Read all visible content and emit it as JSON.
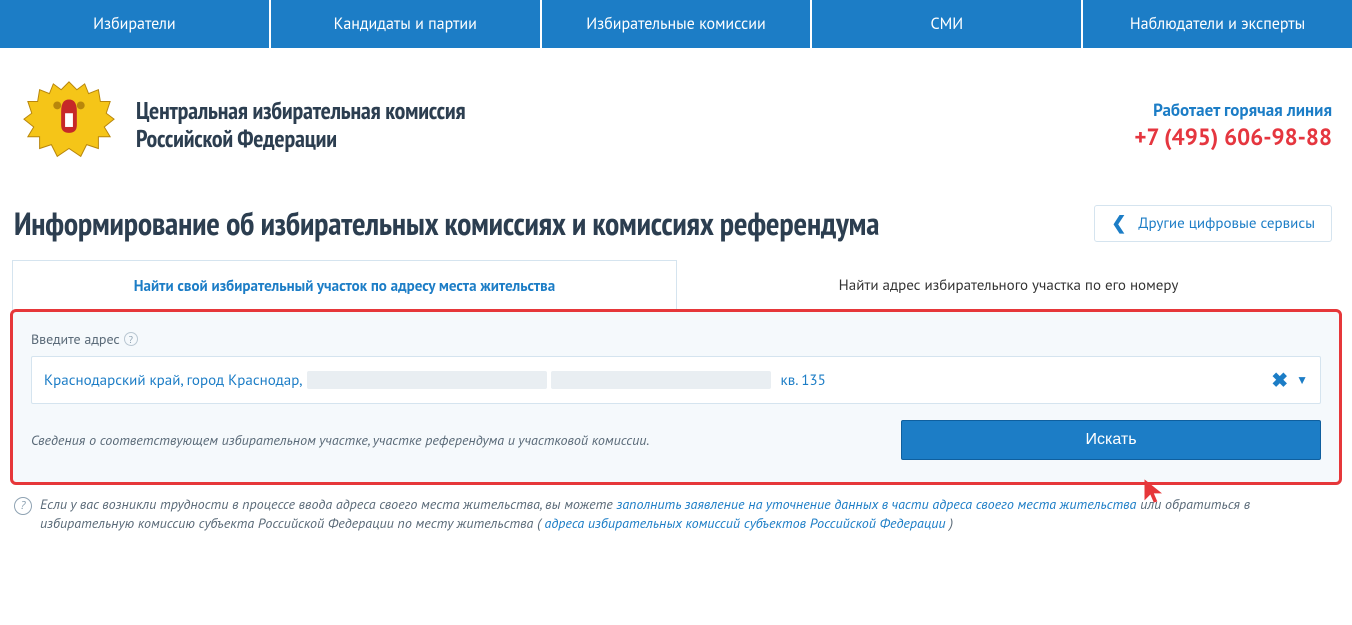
{
  "topnav": {
    "items": [
      "Избиратели",
      "Кандидаты и партии",
      "Избирательные комиссии",
      "СМИ",
      "Наблюдатели и эксперты"
    ]
  },
  "org": {
    "line1": "Центральная избирательная комиссия",
    "line2": "Российской Федерации"
  },
  "hotline": {
    "label": "Работает горячая линия",
    "phone": "+7 (495) 606-98-88"
  },
  "page": {
    "title": "Информирование об избирательных комиссиях и комиссиях референдума",
    "other_services": "Другие цифровые сервисы"
  },
  "tabs": {
    "active": "Найти свой избирательный участок по адресу места жительства",
    "inactive": "Найти адрес избирательного участка по его номеру"
  },
  "form": {
    "label": "Введите адрес",
    "address_prefix": "Краснодарский край, город Краснодар,",
    "address_suffix": "кв. 135",
    "description": "Сведения о соответствующем избирательном участке, участке референдума и участковой комиссии.",
    "search_button": "Искать"
  },
  "footer": {
    "part1": "Если у вас возникли трудности в процессе ввода адреса своего места жительства, вы можете ",
    "link1": "заполнить заявление на уточнение данных в части адреса своего места жительства",
    "part2": " или обратиться в избирательную комиссию субъекта Российской Федерации по месту жительства ( ",
    "link2": "адреса избирательных комиссий субъектов Российской Федерации",
    "part3": " )"
  }
}
